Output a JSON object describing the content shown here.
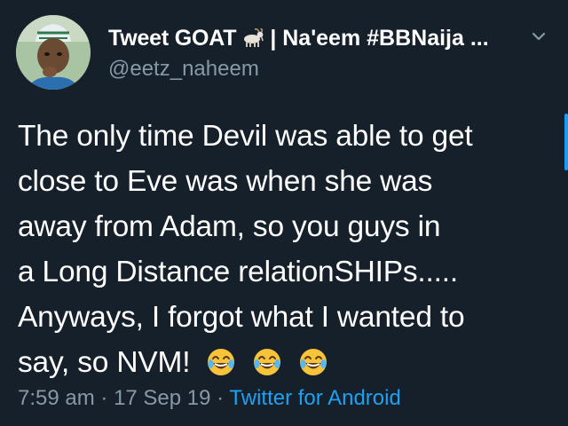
{
  "tweet": {
    "display_name": "Tweet GOAT",
    "goat_icon": "goat-emoji",
    "display_name_rest": "| Na'eem #BBNaija ...",
    "handle": "@eetz_naheem",
    "lines": [
      "The only time Devil was able to get",
      "close to Eve was when she was",
      "away from Adam, so you guys in",
      "a Long Distance relationSHIPs.....",
      "Anyways, I forgot what I wanted to",
      "say, so NVM!"
    ],
    "emojis": [
      "tears-of-joy-emoji",
      "tears-of-joy-emoji",
      "tears-of-joy-emoji"
    ],
    "time": "7:59 am",
    "sep1": "·",
    "date": "17 Sep 19",
    "sep2": "·",
    "source": "Twitter for Android"
  },
  "colors": {
    "background": "#15202b",
    "text": "#ffffff",
    "secondary": "#8899a6",
    "link": "#1da1f2",
    "emoji_face": "#f7c33b"
  }
}
